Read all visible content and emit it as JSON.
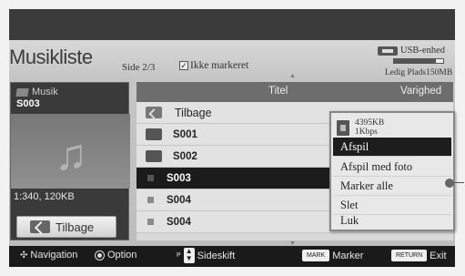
{
  "header": {
    "title": "Musikliste",
    "page_info": "Side 2/3",
    "unmarked_label": "Ikke markeret",
    "usb_label": "USB-enhed",
    "free_space": "Ledig Plads150MB",
    "free_space_fill": 0.85
  },
  "preview": {
    "category": "Musik",
    "file_name": "S003",
    "meta": "1:340, 120KB",
    "back_label": "Tilbage"
  },
  "list": {
    "col_title": "Titel",
    "col_duration": "Varighed",
    "rows": [
      {
        "label": "Tilbage"
      },
      {
        "label": "S001"
      },
      {
        "label": "S002"
      },
      {
        "label": "S003"
      },
      {
        "label": "S004"
      },
      {
        "label": "S004"
      }
    ]
  },
  "popup": {
    "size": "4395KB",
    "bitrate": "1Kbps",
    "items": [
      "Afspil",
      "Afspil med foto",
      "Marker alle",
      "Slet",
      "Luk"
    ]
  },
  "footer": {
    "navigation": "Navigation",
    "option": "Option",
    "page_key": "P",
    "page_change": "Sideskift",
    "mark_key": "MARK",
    "mark": "Marker",
    "return_key": "RETURN",
    "exit": "Exit"
  }
}
